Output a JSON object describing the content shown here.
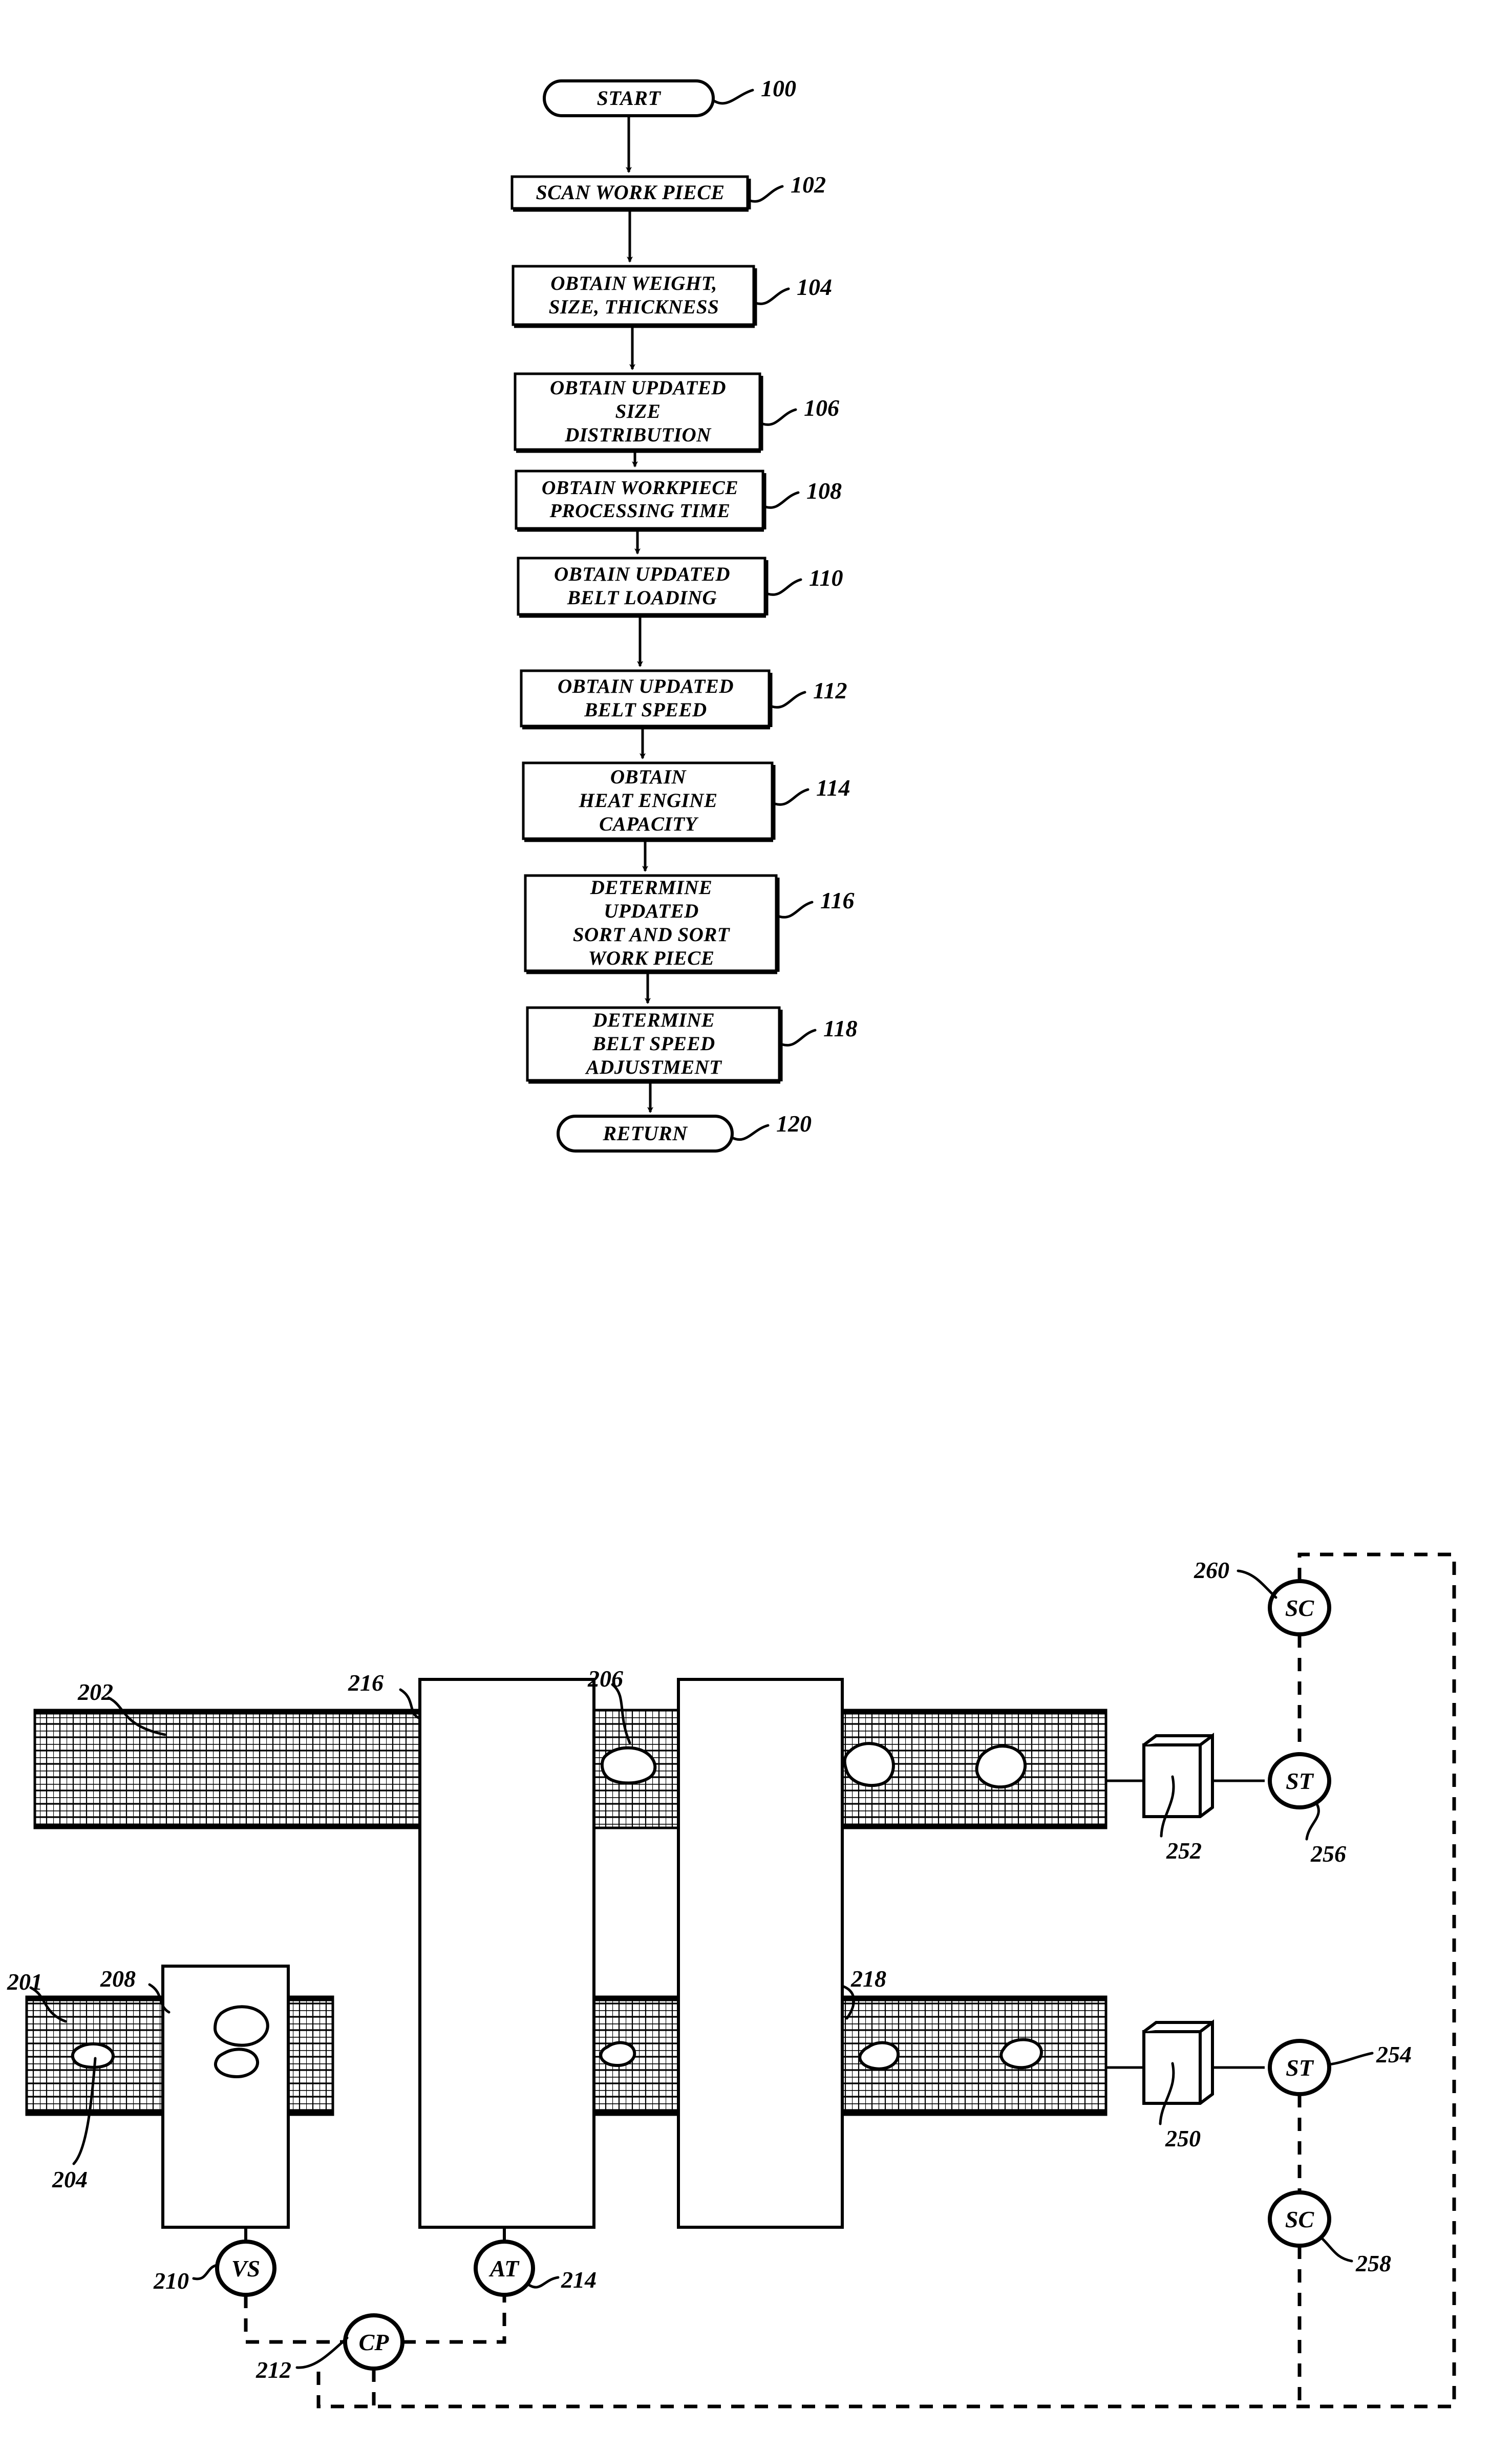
{
  "figure": {
    "kind": "patent-drawing",
    "ink_color": "#000000",
    "background_color": "#ffffff"
  },
  "flowchart": {
    "start_label": "START",
    "end_label": "RETURN",
    "steps": [
      {
        "ref": "100",
        "text": "START",
        "shape": "terminator"
      },
      {
        "ref": "102",
        "text": "SCAN WORK PIECE",
        "shape": "process"
      },
      {
        "ref": "104",
        "text": "OBTAIN WEIGHT,\nSIZE, THICKNESS",
        "shape": "process"
      },
      {
        "ref": "106",
        "text": "OBTAIN UPDATED\nSIZE\nDISTRIBUTION",
        "shape": "process"
      },
      {
        "ref": "108",
        "text": "OBTAIN WORKPIECE\nPROCESSING TIME",
        "shape": "process"
      },
      {
        "ref": "110",
        "text": "OBTAIN UPDATED\nBELT LOADING",
        "shape": "process"
      },
      {
        "ref": "112",
        "text": "OBTAIN UPDATED\nBELT SPEED",
        "shape": "process"
      },
      {
        "ref": "114",
        "text": "OBTAIN\nHEAT ENGINE\nCAPACITY",
        "shape": "process"
      },
      {
        "ref": "116",
        "text": "DETERMINE\nUPDATED\nSORT AND SORT\nWORK PIECE",
        "shape": "process"
      },
      {
        "ref": "118",
        "text": "DETERMINE\nBELT SPEED\nADJUSTMENT",
        "shape": "process"
      },
      {
        "ref": "120",
        "text": "RETURN",
        "shape": "terminator"
      }
    ]
  },
  "apparatus": {
    "reference_numerals": [
      {
        "ref": "201",
        "describes": "lower-conveyor-belt"
      },
      {
        "ref": "202",
        "describes": "upper-conveyor-belt"
      },
      {
        "ref": "204",
        "describes": "work-piece-on-lower-belt"
      },
      {
        "ref": "206",
        "describes": "work-piece-on-upper-belt"
      },
      {
        "ref": "208",
        "describes": "scanner-station"
      },
      {
        "ref": "210",
        "describes": "velocity-sensor"
      },
      {
        "ref": "212",
        "describes": "control-processor"
      },
      {
        "ref": "214",
        "describes": "actuator"
      },
      {
        "ref": "216",
        "describes": "first-processing-module"
      },
      {
        "ref": "218",
        "describes": "second-processing-module"
      },
      {
        "ref": "250",
        "describes": "lower-outlet-roller"
      },
      {
        "ref": "252",
        "describes": "upper-outlet-roller"
      },
      {
        "ref": "254",
        "describes": "lower-sort-transducer"
      },
      {
        "ref": "256",
        "describes": "upper-sort-transducer"
      },
      {
        "ref": "258",
        "describes": "lower-sort-controller"
      },
      {
        "ref": "260",
        "describes": "upper-sort-controller"
      }
    ],
    "sensor_nodes": [
      {
        "ref": "260",
        "code": "SC",
        "name": "upper-sort-controller"
      },
      {
        "ref": "256",
        "code": "ST",
        "name": "upper-sort-transducer"
      },
      {
        "ref": "254",
        "code": "ST",
        "name": "lower-sort-transducer"
      },
      {
        "ref": "258",
        "code": "SC",
        "name": "lower-sort-controller"
      },
      {
        "ref": "210",
        "code": "VS",
        "name": "velocity-sensor"
      },
      {
        "ref": "214",
        "code": "AT",
        "name": "actuator"
      },
      {
        "ref": "212",
        "code": "CP",
        "name": "control-processor"
      }
    ]
  }
}
